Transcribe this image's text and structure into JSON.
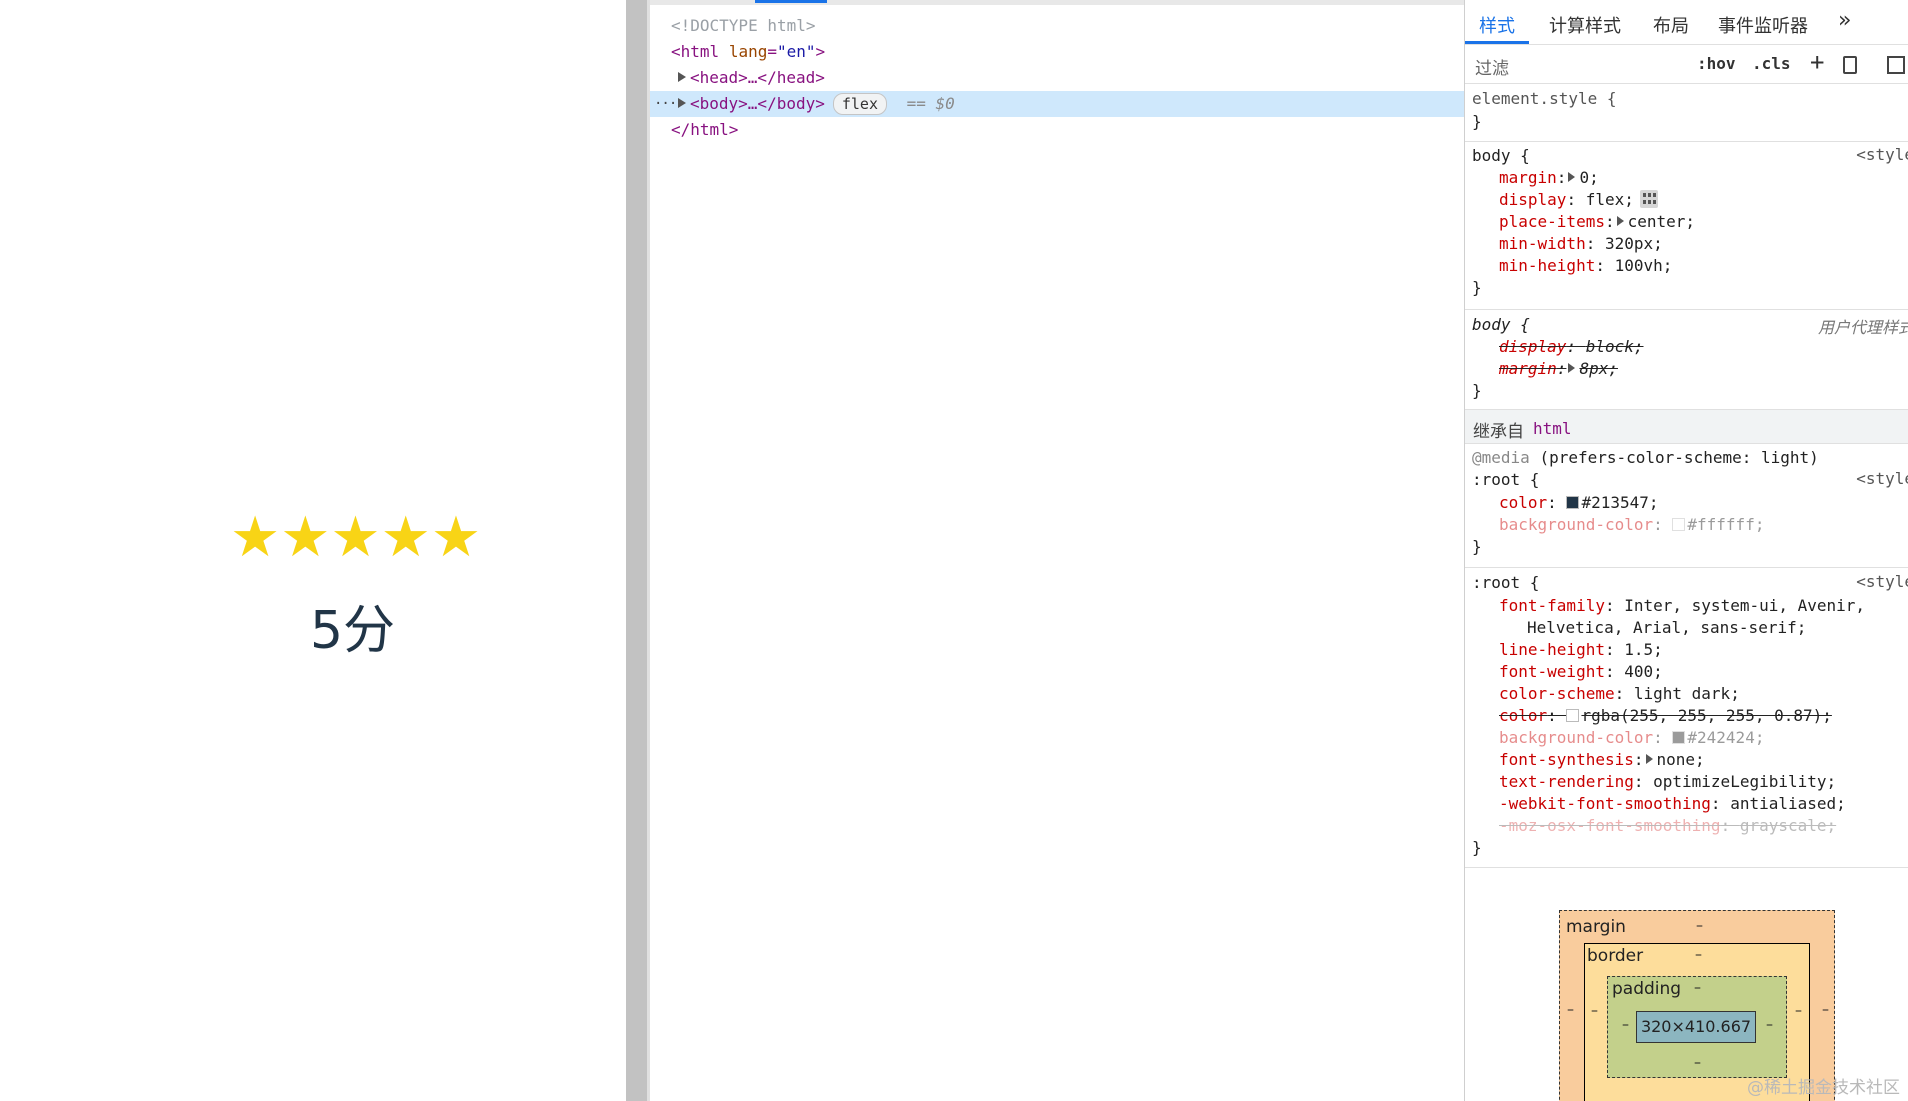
{
  "preview": {
    "stars": [
      "★",
      "★",
      "★",
      "★",
      "★"
    ],
    "score_text": "5分"
  },
  "elements": {
    "doctype": "<!DOCTYPE html>",
    "html_open": "<html",
    "lang_attr": "lang",
    "lang_value": "\"en\"",
    "gt": ">",
    "head": "<head>…</head>",
    "body": "<body>…</body>",
    "flex_badge": "flex",
    "selected_marker": "== $0",
    "html_close": "</html>",
    "ellipsis": "···"
  },
  "styles_panel": {
    "tabs": [
      "样式",
      "计算样式",
      "布局",
      "事件监听器"
    ],
    "more_tabs": "»",
    "filter_placeholder": "过滤",
    "hov": ":hov",
    "cls": ".cls",
    "add": "+",
    "element_style": {
      "selector": "element.style {",
      "close": "}"
    },
    "body_rule": {
      "selector": "body {",
      "source": "<style",
      "props": [
        {
          "name": "margin",
          "value": "0;"
        },
        {
          "name": "display",
          "value": "flex;"
        },
        {
          "name": "place-items",
          "value": "center;"
        },
        {
          "name": "min-width",
          "value": "320px;"
        },
        {
          "name": "min-height",
          "value": "100vh;"
        }
      ],
      "close": "}"
    },
    "ua_rule": {
      "selector": "body {",
      "source": "用户代理样式",
      "props": [
        {
          "name": "display",
          "value": "block;"
        },
        {
          "name": "margin",
          "value": "8px;"
        }
      ],
      "close": "}"
    },
    "inherited": {
      "label": "继承自",
      "from": "html"
    },
    "media_rule": {
      "media": "@media",
      "media_query": "(prefers-color-scheme: light)",
      "selector": ":root {",
      "source": "<style",
      "props": [
        {
          "name": "color",
          "value": "#213547;",
          "swatch": "#213547"
        },
        {
          "name": "background-color",
          "value": "#ffffff;",
          "swatch": "#ffffff"
        }
      ],
      "close": "}"
    },
    "root_rule": {
      "selector": ":root {",
      "source": "<style",
      "props": [
        {
          "name": "font-family",
          "value": "Inter, system-ui, Avenir,"
        },
        {
          "name": "",
          "value": "Helvetica, Arial, sans-serif;"
        },
        {
          "name": "line-height",
          "value": "1.5;"
        },
        {
          "name": "font-weight",
          "value": "400;"
        },
        {
          "name": "color-scheme",
          "value": "light dark;"
        },
        {
          "name": "color",
          "value": "rgba(255, 255, 255, 0.87);",
          "swatch": "#ffffff"
        },
        {
          "name": "background-color",
          "value": "#242424;",
          "swatch": "#242424"
        },
        {
          "name": "font-synthesis",
          "value": "none;"
        },
        {
          "name": "text-rendering",
          "value": "optimizeLegibility;"
        },
        {
          "name": "-webkit-font-smoothing",
          "value": "antialiased;"
        },
        {
          "name": "-moz-osx-font-smoothing",
          "value": "grayscale;"
        }
      ],
      "close": "}"
    },
    "box_model": {
      "margin_label": "margin",
      "border_label": "border",
      "padding_label": "padding",
      "content_size": "320×410.667",
      "dash": "–"
    },
    "watermark": "@稀土掘金技术社区"
  },
  "colors": {
    "star": "#f8d416",
    "score_text": "#213547",
    "accent": "#1a73e8",
    "selected_row": "#cfe8fc"
  }
}
